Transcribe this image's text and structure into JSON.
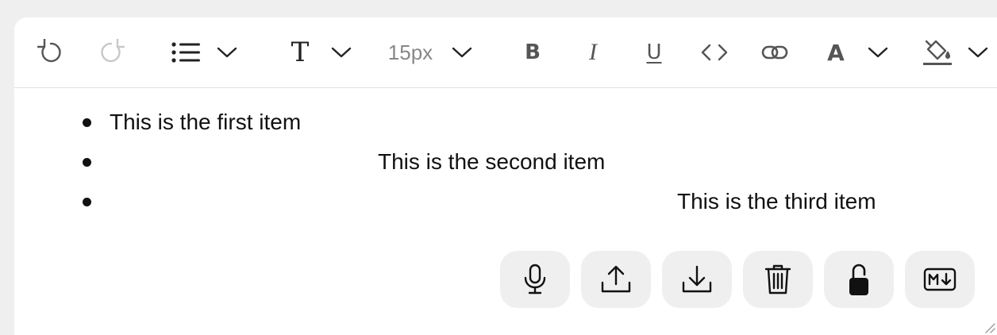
{
  "toolbar": {
    "font_size_value": "15px",
    "bold_glyph": "B",
    "italic_glyph": "I",
    "underline_glyph": "U",
    "font_glyph": "T",
    "text_color_glyph": "A",
    "icons": {
      "undo": "undo-icon",
      "redo": "redo-icon",
      "list": "list-icon",
      "code": "code-icon",
      "link": "link-icon",
      "highlight": "paint-bucket-icon"
    },
    "disabled_color": "#c8c8c8",
    "icon_color": "#555555"
  },
  "document": {
    "items": [
      {
        "text": "This is the first item"
      },
      {
        "text": "This is the second item"
      },
      {
        "text": "This is the third item"
      }
    ]
  },
  "actions": {
    "icons": [
      "microphone-icon",
      "upload-icon",
      "download-icon",
      "trash-icon",
      "lock-icon",
      "markdown-icon"
    ]
  }
}
